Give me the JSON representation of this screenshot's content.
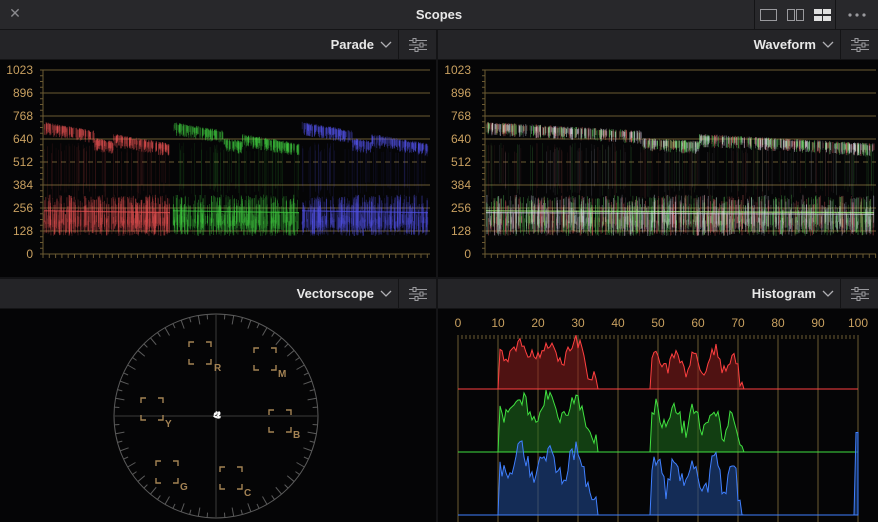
{
  "window": {
    "title": "Scopes"
  },
  "panels": {
    "parade": {
      "name": "Parade"
    },
    "waveform": {
      "name": "Waveform"
    },
    "vectorscope": {
      "name": "Vectorscope"
    },
    "histogram": {
      "name": "Histogram"
    }
  },
  "waveform_axis": [
    "1023",
    "896",
    "768",
    "640",
    "512",
    "384",
    "256",
    "128",
    "0"
  ],
  "histogram_axis": [
    "0",
    "10",
    "20",
    "30",
    "40",
    "50",
    "60",
    "70",
    "80",
    "90",
    "100"
  ],
  "vectorscope_targets": [
    "R",
    "M",
    "Y",
    "B",
    "G",
    "C"
  ],
  "colors": {
    "axis_label": "#c8a060",
    "red_trace": "#ff5a5a",
    "green_trace": "#46e046",
    "blue_trace": "#5a5aff",
    "vector_target": "#a48354"
  },
  "icons": {
    "close": "close-icon",
    "layout_single": "single-layout-icon",
    "layout_dual": "dual-layout-icon",
    "layout_quad": "quad-layout-icon",
    "more": "more-options-icon",
    "chevron": "chevron-down-icon",
    "settings": "sliders-icon"
  }
}
